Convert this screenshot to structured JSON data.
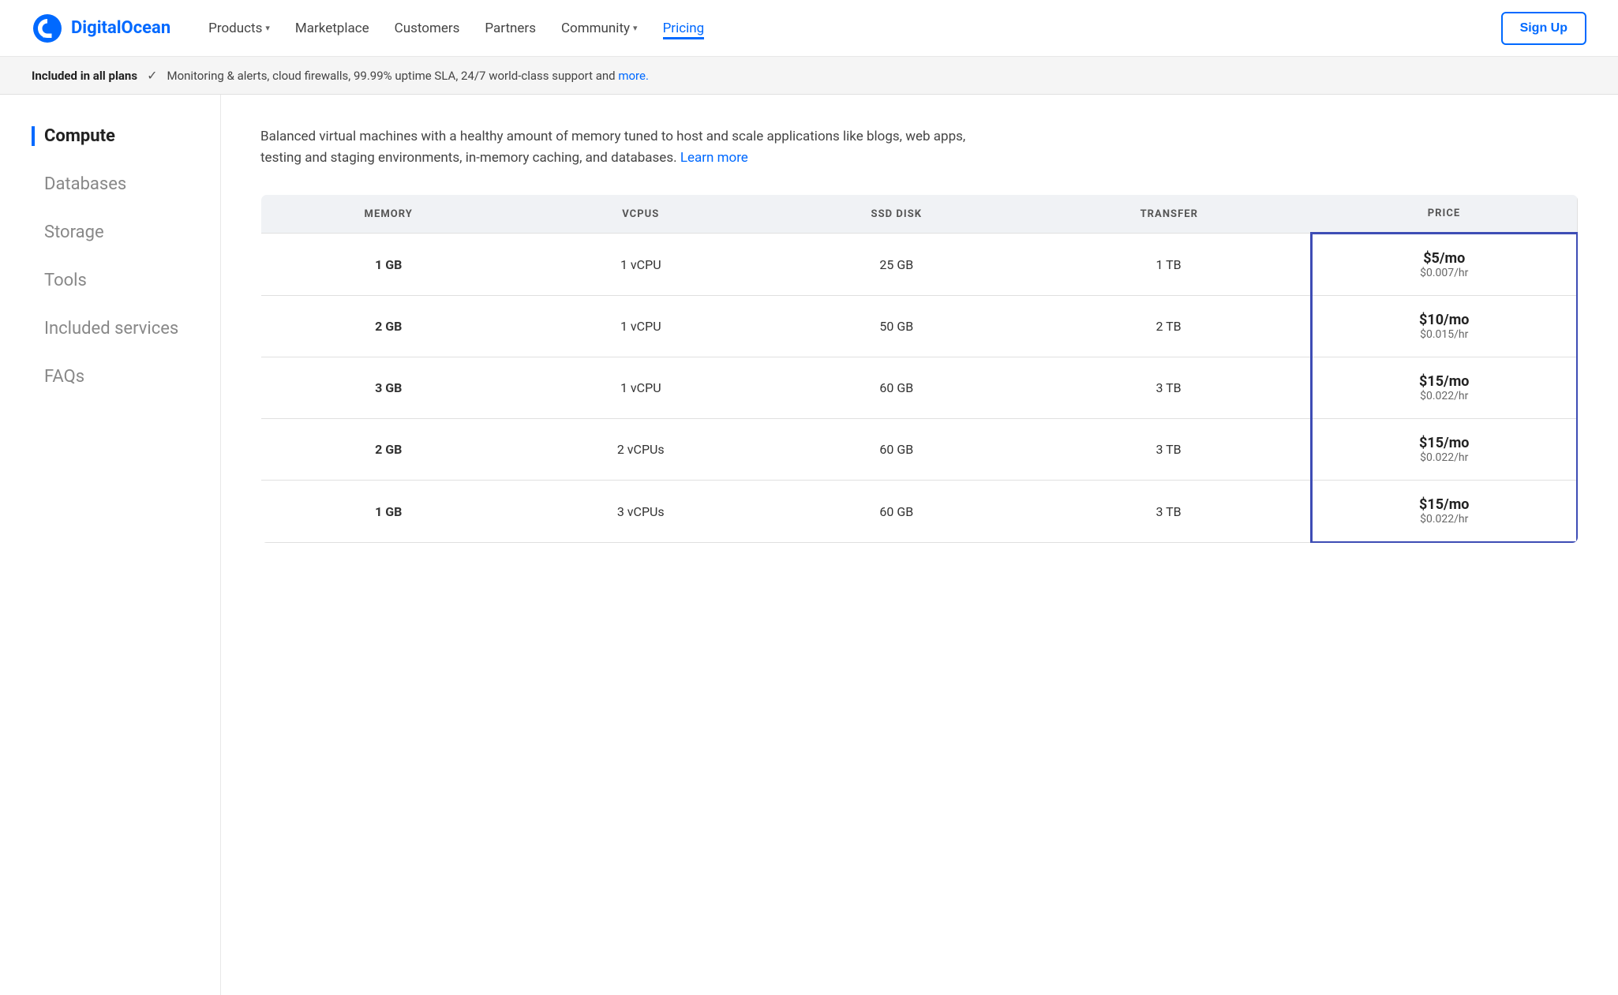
{
  "brand": {
    "name": "DigitalOcean",
    "logo_alt": "DigitalOcean logo"
  },
  "nav": {
    "links": [
      {
        "id": "products",
        "label": "Products",
        "has_dropdown": true,
        "active": false
      },
      {
        "id": "marketplace",
        "label": "Marketplace",
        "has_dropdown": false,
        "active": false
      },
      {
        "id": "customers",
        "label": "Customers",
        "has_dropdown": false,
        "active": false
      },
      {
        "id": "partners",
        "label": "Partners",
        "has_dropdown": false,
        "active": false
      },
      {
        "id": "community",
        "label": "Community",
        "has_dropdown": true,
        "active": false
      },
      {
        "id": "pricing",
        "label": "Pricing",
        "has_dropdown": false,
        "active": true
      }
    ],
    "signup_label": "Sign Up"
  },
  "included_bar": {
    "label": "Included in all plans",
    "check": "✓",
    "description": "Monitoring & alerts, cloud firewalls, 99.99% uptime SLA, 24/7 world-class support and ",
    "link_text": "more."
  },
  "sidebar": {
    "items": [
      {
        "id": "compute",
        "label": "Compute",
        "active": true
      },
      {
        "id": "databases",
        "label": "Databases",
        "active": false
      },
      {
        "id": "storage",
        "label": "Storage",
        "active": false
      },
      {
        "id": "tools",
        "label": "Tools",
        "active": false
      },
      {
        "id": "included-services",
        "label": "Included services",
        "active": false
      },
      {
        "id": "faqs",
        "label": "FAQs",
        "active": false
      }
    ]
  },
  "content": {
    "description": "Balanced virtual machines with a healthy amount of memory tuned to host and scale applications like blogs, web apps, testing and staging environments, in-memory caching, and databases. ",
    "learn_more_link": "Learn more",
    "table": {
      "headers": [
        "MEMORY",
        "VCPUS",
        "SSD DISK",
        "TRANSFER",
        "PRICE"
      ],
      "rows": [
        {
          "memory": "1 GB",
          "vcpus": "1 vCPU",
          "ssd_disk": "25 GB",
          "transfer": "1 TB",
          "price_mo": "$5/mo",
          "price_hr": "$0.007/hr"
        },
        {
          "memory": "2 GB",
          "vcpus": "1 vCPU",
          "ssd_disk": "50 GB",
          "transfer": "2 TB",
          "price_mo": "$10/mo",
          "price_hr": "$0.015/hr"
        },
        {
          "memory": "3 GB",
          "vcpus": "1 vCPU",
          "ssd_disk": "60 GB",
          "transfer": "3 TB",
          "price_mo": "$15/mo",
          "price_hr": "$0.022/hr"
        },
        {
          "memory": "2 GB",
          "vcpus": "2 vCPUs",
          "ssd_disk": "60 GB",
          "transfer": "3 TB",
          "price_mo": "$15/mo",
          "price_hr": "$0.022/hr"
        },
        {
          "memory": "1 GB",
          "vcpus": "3 vCPUs",
          "ssd_disk": "60 GB",
          "transfer": "3 TB",
          "price_mo": "$15/mo",
          "price_hr": "$0.022/hr"
        }
      ]
    }
  },
  "colors": {
    "brand_blue": "#0069ff",
    "price_border": "#3e4db5"
  }
}
